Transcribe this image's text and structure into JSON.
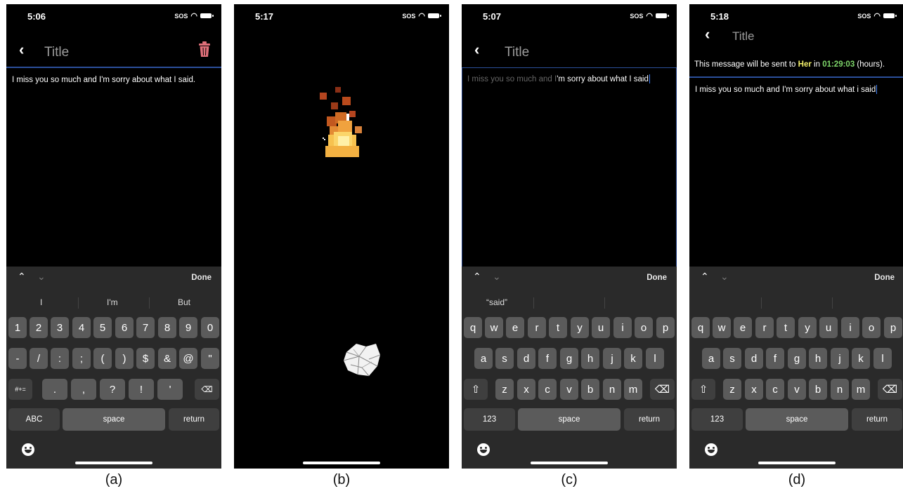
{
  "screens": [
    {
      "id": "a",
      "caption": "(a)",
      "time": "5:06",
      "status_sos": "SOS",
      "title": "Title",
      "note_text": "I miss you so much and I'm sorry about what I said.",
      "toolbar_done": "Done",
      "suggestions": [
        "I",
        "I'm",
        "But"
      ],
      "keys_row1": [
        "1",
        "2",
        "3",
        "4",
        "5",
        "6",
        "7",
        "8",
        "9",
        "0"
      ],
      "keys_row2": [
        "-",
        "/",
        ":",
        ";",
        "(",
        ")",
        "$",
        "&",
        "@",
        "\""
      ],
      "keys_row3_mode": "#+=",
      "keys_row3": [
        ".",
        ",",
        "?",
        "!",
        "'"
      ],
      "key_abc": "ABC",
      "key_space": "space",
      "key_return": "return"
    },
    {
      "id": "b",
      "caption": "(b)",
      "time": "5:17",
      "status_sos": "SOS",
      "icons": [
        "fire-animation",
        "crumpled-paper"
      ]
    },
    {
      "id": "c",
      "caption": "(c)",
      "time": "5:07",
      "status_sos": "SOS",
      "title": "Title",
      "note_text_faded": "I miss you so much and I",
      "note_text": "'m sorry about what I said",
      "toolbar_done": "Done",
      "suggestions": [
        "“said”"
      ],
      "keys_row1": [
        "q",
        "w",
        "e",
        "r",
        "t",
        "y",
        "u",
        "i",
        "o",
        "p"
      ],
      "keys_row2": [
        "a",
        "s",
        "d",
        "f",
        "g",
        "h",
        "j",
        "k",
        "l"
      ],
      "keys_row3": [
        "z",
        "x",
        "c",
        "v",
        "b",
        "n",
        "m"
      ],
      "key_123": "123",
      "key_space": "space",
      "key_return": "return"
    },
    {
      "id": "d",
      "caption": "(d)",
      "time": "5:18",
      "status_sos": "SOS",
      "title": "Title",
      "banner": {
        "prefix": "This message will be sent to ",
        "recipient": "Her",
        "middle": " in ",
        "countdown": "01:29:03",
        "suffix": " (hours)."
      },
      "note_text": "I miss you so much and I'm sorry about what i said",
      "toolbar_done": "Done",
      "keys_row1": [
        "q",
        "w",
        "e",
        "r",
        "t",
        "y",
        "u",
        "i",
        "o",
        "p"
      ],
      "keys_row2": [
        "a",
        "s",
        "d",
        "f",
        "g",
        "h",
        "j",
        "k",
        "l"
      ],
      "keys_row3": [
        "z",
        "x",
        "c",
        "v",
        "b",
        "n",
        "m"
      ],
      "key_123": "123",
      "key_space": "space",
      "key_return": "return"
    }
  ],
  "colors": {
    "separator": "#2b4f9b",
    "trash_icon": "#e0707a",
    "recipient_highlight": "#f4f16b",
    "countdown_highlight": "#7fd76b",
    "keyboard_bg": "#2a2a2a",
    "key_bg": "#5b5b5b"
  }
}
